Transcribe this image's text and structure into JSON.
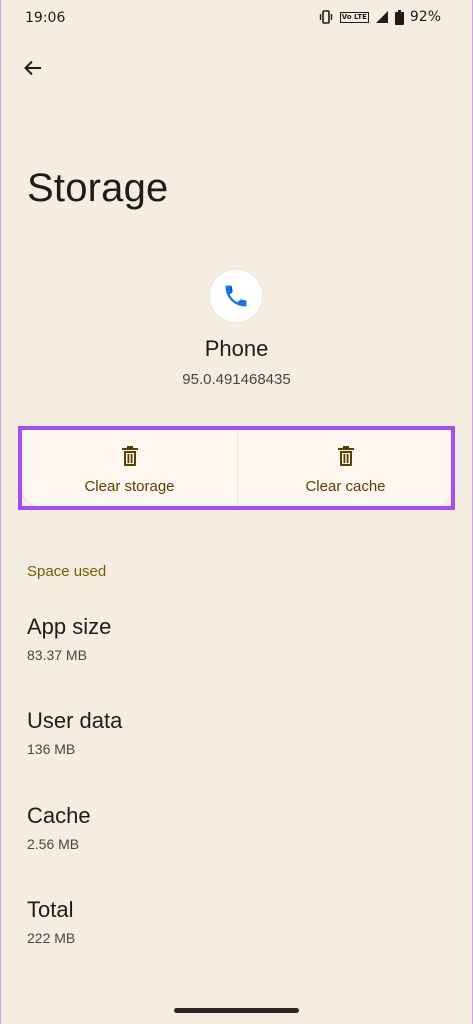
{
  "status_bar": {
    "time": "19:06",
    "volte": "Vo LTE",
    "battery_percent": "92%"
  },
  "page": {
    "title": "Storage"
  },
  "app": {
    "name": "Phone",
    "version": "95.0.491468435",
    "icon": "phone-icon",
    "icon_color": "#1a73e8"
  },
  "actions": [
    {
      "label": "Clear storage",
      "icon": "trash-icon"
    },
    {
      "label": "Clear cache",
      "icon": "trash-icon"
    }
  ],
  "space_used": {
    "header": "Space used",
    "rows": [
      {
        "title": "App size",
        "value": "83.37 MB"
      },
      {
        "title": "User data",
        "value": "136 MB"
      },
      {
        "title": "Cache",
        "value": "2.56 MB"
      },
      {
        "title": "Total",
        "value": "222 MB"
      }
    ]
  },
  "colors": {
    "background": "#f6ede2",
    "accent": "#7a5b00",
    "highlight": "#a64cf0"
  }
}
